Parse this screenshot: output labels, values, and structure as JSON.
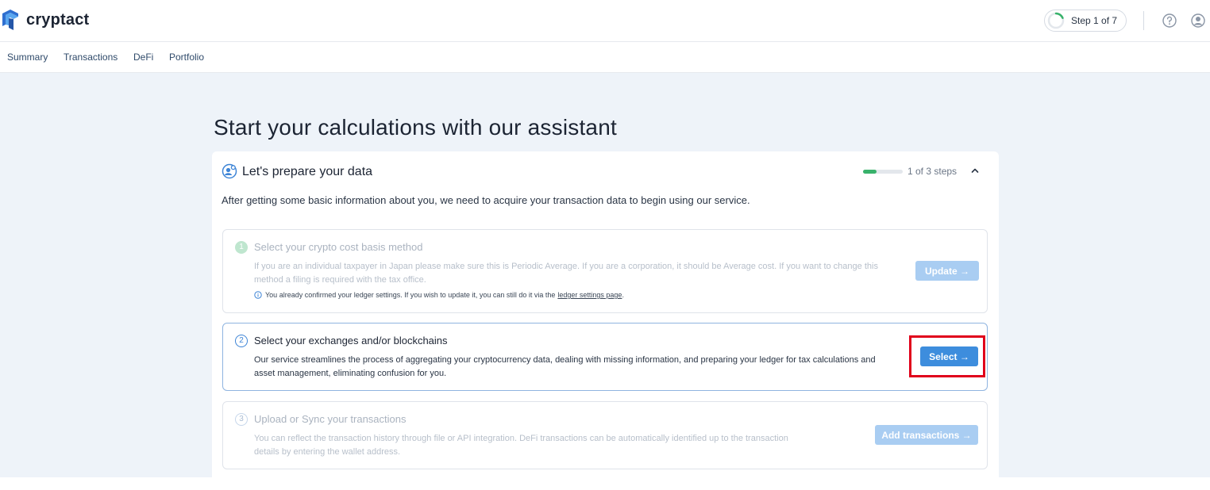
{
  "header": {
    "logo_text": "cryptact",
    "step_indicator": "Step 1 of 7",
    "icons": [
      "help-circle-icon",
      "user-account-icon"
    ],
    "colors": {
      "progress": "#38b26b",
      "accent": "#3d8ddd"
    }
  },
  "nav": {
    "items": [
      "Summary",
      "Transactions",
      "DeFi",
      "Portfolio"
    ]
  },
  "main": {
    "title": "Start your calculations with our assistant",
    "card": {
      "title": "Let's prepare your data",
      "progress_label": "1 of 3 steps",
      "progress_fraction": 0.33,
      "description": "After getting some basic information about you, we need to acquire your transaction data to begin using our service.",
      "steps": [
        {
          "number": "1",
          "title": "Select your crypto cost basis method",
          "text": "If you are an individual taxpayer in Japan please make sure this is Periodic Average. If you are a corporation, it should be Average cost. If you want to change this method a filing is required with the tax office.",
          "note": "You already confirmed your ledger settings. If you wish to update it, you can still do it via the",
          "note_link": "ledger settings page",
          "note_end": ".",
          "button": "Update →"
        },
        {
          "number": "2",
          "title": "Select your exchanges and/or blockchains",
          "text": "Our service streamlines the process of aggregating your cryptocurrency data, dealing with missing information, and preparing your ledger for tax calculations and asset management, eliminating confusion for you.",
          "button": "Select →"
        },
        {
          "number": "3",
          "title": "Upload or Sync your transactions",
          "text": "You can reflect the transaction history through file or API integration. DeFi transactions can be automatically identified up to the transaction details by entering the wallet address.",
          "button": "Add transactions →"
        }
      ]
    }
  }
}
